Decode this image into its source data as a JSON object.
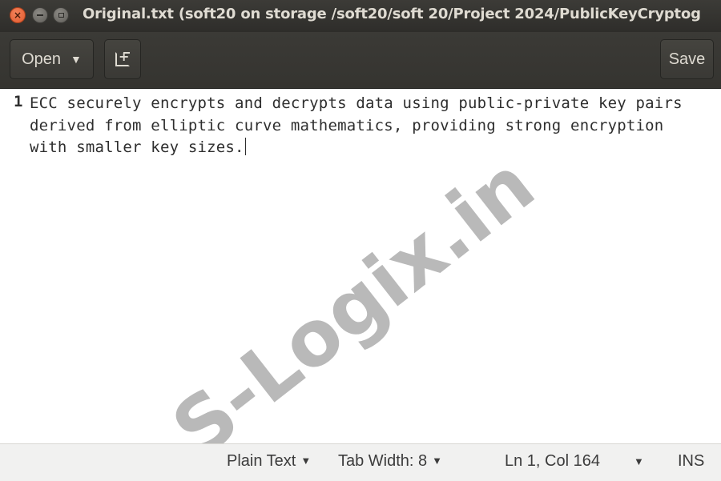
{
  "window": {
    "title": "Original.txt (soft20 on storage /soft20/soft 20/Project 2024/PublicKeyCryptog",
    "close_glyph": "×"
  },
  "toolbar": {
    "open_label": "Open",
    "dropdown_glyph": "▼",
    "save_label": "Save"
  },
  "editor": {
    "line_number": "1",
    "text": "ECC securely encrypts and decrypts data using public-private key pairs derived from elliptic curve mathematics, providing strong encryption with smaller key sizes."
  },
  "watermark": {
    "text": "S-Logix.in"
  },
  "statusbar": {
    "language": "Plain Text",
    "tab_width": "Tab Width: 8",
    "position": "Ln 1, Col 164",
    "mode": "INS",
    "dropdown_glyph": "▼"
  },
  "colors": {
    "titlebar_bg": "#3c3b37",
    "close_button": "#e05a2e",
    "editor_bg": "#ffffff",
    "statusbar_bg": "#f1f1f0"
  }
}
